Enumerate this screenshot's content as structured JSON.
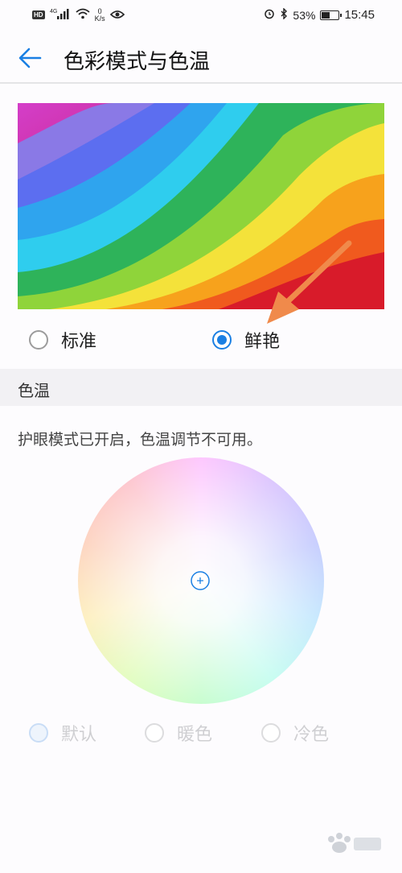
{
  "status_bar": {
    "left_badge": "HD",
    "signal_label": "4G",
    "net_speed_value": "0",
    "net_speed_unit": "K/s",
    "battery": "53%",
    "time": "15:45",
    "battery_level": 0.53
  },
  "header": {
    "title": "色彩模式与色温"
  },
  "color_mode": {
    "options": [
      {
        "label": "标准",
        "selected": false
      },
      {
        "label": "鲜艳",
        "selected": true
      }
    ]
  },
  "color_temp": {
    "section_title": "色温",
    "info": "护眼模式已开启，色温调节不可用。",
    "options": [
      {
        "label": "默认",
        "selected": true
      },
      {
        "label": "暖色",
        "selected": false
      },
      {
        "label": "冷色",
        "selected": false
      }
    ]
  },
  "colors": {
    "accent": "#1a7fe3",
    "annotation_arrow": "#f08a4b"
  }
}
